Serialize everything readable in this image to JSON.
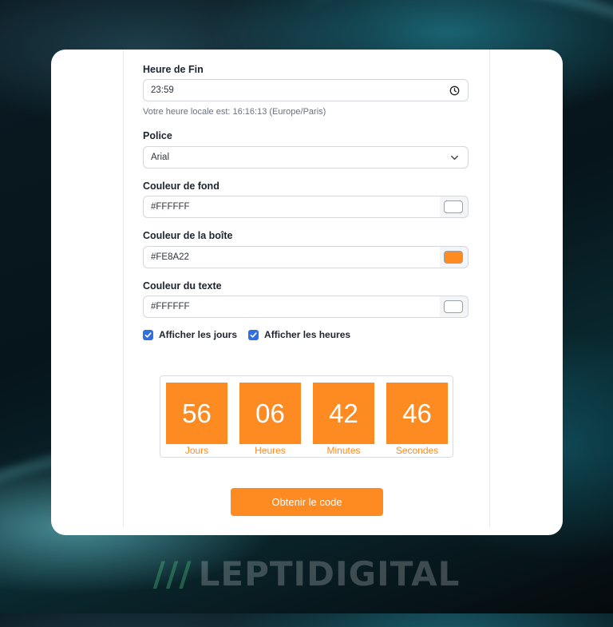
{
  "colors": {
    "accent": "#FE8A22",
    "checkbox": "#2F6FE0",
    "brand_mark": "#3AA56A"
  },
  "form": {
    "end_time": {
      "label": "Heure de Fin",
      "value": "23:59",
      "icon": "clock-icon"
    },
    "local_time_hint": "Votre heure locale est: 16:16:13 (Europe/Paris)",
    "font": {
      "label": "Police",
      "value": "Arial",
      "icon": "chevron-down-icon"
    },
    "bg_color": {
      "label": "Couleur de fond",
      "value": "#FFFFFF",
      "swatch": "#FFFFFF"
    },
    "box_color": {
      "label": "Couleur de la boîte",
      "value": "#FE8A22",
      "swatch": "#FE8A22"
    },
    "text_color": {
      "label": "Couleur du texte",
      "value": "#FFFFFF",
      "swatch": "#FFFFFF"
    },
    "show_days": {
      "label": "Afficher les jours",
      "checked": true
    },
    "show_hours": {
      "label": "Afficher les heures",
      "checked": true
    }
  },
  "countdown": {
    "days": {
      "value": "56",
      "label": "Jours"
    },
    "hours": {
      "value": "06",
      "label": "Heures"
    },
    "minutes": {
      "value": "42",
      "label": "Minutes"
    },
    "seconds": {
      "value": "46",
      "label": "Secondes"
    }
  },
  "cta_label": "Obtenir le code",
  "brand": {
    "mark": "///",
    "name": "LEPTIDIGITAL"
  }
}
